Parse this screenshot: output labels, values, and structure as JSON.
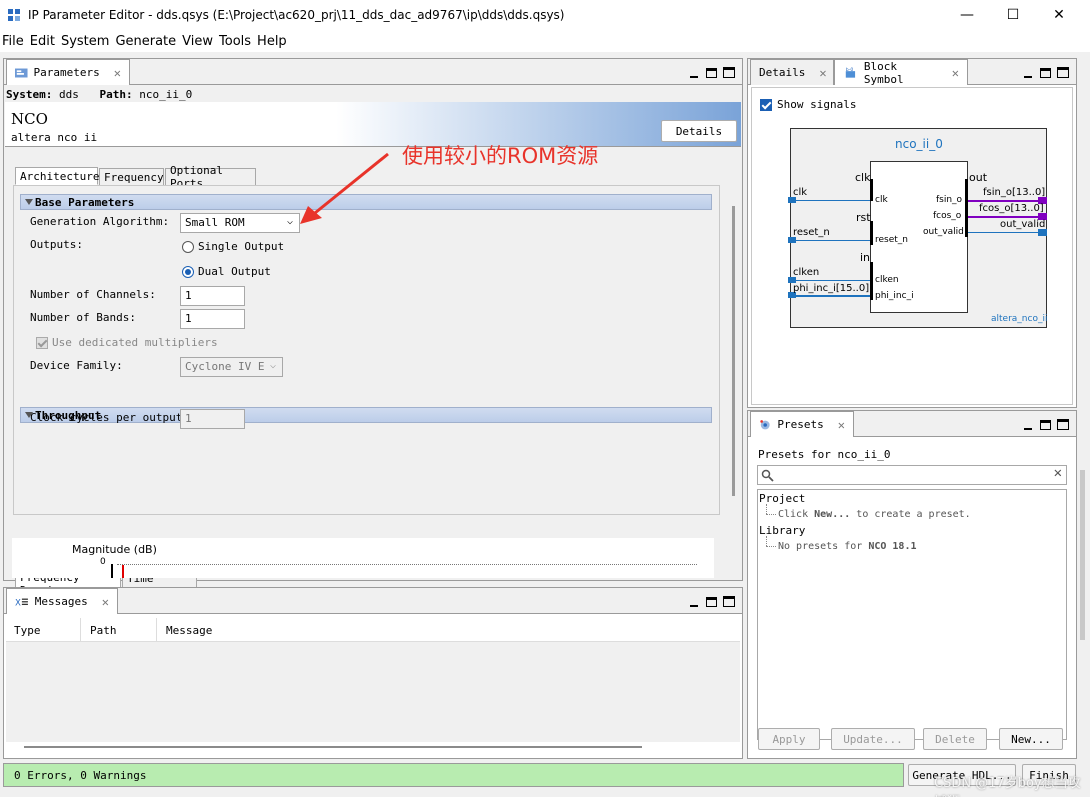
{
  "window": {
    "title": "IP Parameter Editor - dds.qsys (E:\\Project\\ac620_prj\\11_dds_dac_ad9767\\ip\\dds\\dds.qsys)",
    "minimize": "—",
    "maximize": "☐",
    "close": "✕"
  },
  "menu": [
    "File",
    "Edit",
    "System",
    "Generate",
    "View",
    "Tools",
    "Help"
  ],
  "parameters_panel": {
    "tab_label": "Parameters",
    "system_label": "System:",
    "system_value": "dds",
    "path_label": "Path:",
    "path_value": "nco_ii_0",
    "component_title": "NCO",
    "component_subtitle": "altera nco ii",
    "details_button": "Details",
    "subtabs": [
      "Architecture",
      "Frequency",
      "Optional Ports"
    ],
    "base_parameters": {
      "heading": "Base Parameters",
      "generation_algorithm_label": "Generation Algorithm:",
      "generation_algorithm_value": "Small ROM",
      "outputs_label": "Outputs:",
      "output_single": "Single Output",
      "output_dual": "Dual Output",
      "output_selected": "Dual Output",
      "channels_label": "Number of Channels:",
      "channels_value": "1",
      "bands_label": "Number of Bands:",
      "bands_value": "1",
      "dedicated_multipliers_label": "Use dedicated multipliers",
      "device_family_label": "Device Family:",
      "device_family_value": "Cyclone IV E"
    },
    "throughput": {
      "heading": "Throughput",
      "clock_cycles_label": "Clock cycles per output:",
      "clock_cycles_value": "1"
    },
    "plot_tabs": [
      "Frequency Domain",
      "Time Domain"
    ],
    "plot_ylabel": "Magnitude (dB)",
    "plot_tick": "0"
  },
  "annotation": {
    "text": "使用较小的ROM资源",
    "color": "#e8332a"
  },
  "details_panel": {
    "tabs": [
      "Details",
      "Block Symbol"
    ],
    "show_signals_label": "Show signals",
    "show_signals_checked": true,
    "block": {
      "instance_name": "nco_ii_0",
      "component_name": "altera_nco_ii",
      "left_groups": [
        "clk",
        "rst",
        "in"
      ],
      "right_group": "out",
      "external_inputs": [
        "clk",
        "reset_n",
        "clken",
        "phi_inc_i[15..0]"
      ],
      "internal_inputs": [
        "clk",
        "reset_n",
        "clken",
        "phi_inc_i"
      ],
      "internal_outputs": [
        "fsin_o",
        "fcos_o",
        "out_valid"
      ],
      "external_outputs": [
        "fsin_o[13..0]",
        "fcos_o[13..0]",
        "out_valid"
      ],
      "accent_color": "#1e73be",
      "bus_color": "#8000c0"
    }
  },
  "messages_panel": {
    "tab_label": "Messages",
    "columns": [
      "Type",
      "Path",
      "Message"
    ]
  },
  "presets_panel": {
    "tab_label": "Presets",
    "presets_for_label": "Presets for nco_ii_0",
    "search_placeholder": "",
    "tree": {
      "project_label": "Project",
      "project_hint_prefix": "Click",
      "project_hint_bold": "New...",
      "project_hint_suffix": "to create a preset.",
      "library_label": "Library",
      "library_hint_prefix": "No presets for",
      "library_hint_bold": "NCO 18.1"
    },
    "buttons": [
      "Apply",
      "Update...",
      "Delete",
      "New..."
    ]
  },
  "status": {
    "text": "0 Errors, 0 Warnings",
    "color": "#b8ecb0"
  },
  "footer_buttons": [
    "Generate HDL...",
    "Finish"
  ],
  "watermark": "CSDN @17岁boy想当攻城狮"
}
